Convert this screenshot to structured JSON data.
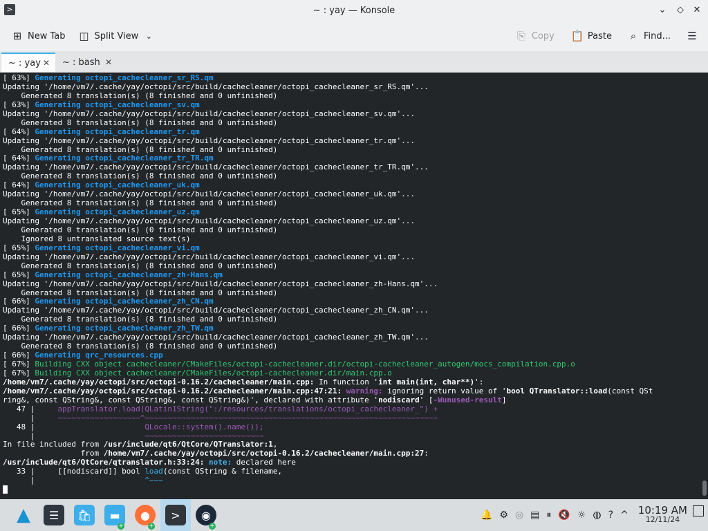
{
  "window": {
    "title": "~ : yay — Konsole",
    "app_icon": ">"
  },
  "toolbar": {
    "new_tab": "New Tab",
    "split_view": "Split View",
    "copy": "Copy",
    "paste": "Paste",
    "find": "Find..."
  },
  "tabs": [
    {
      "label": "~ : yay"
    },
    {
      "label": "~ : bash"
    }
  ],
  "terminal": [
    [
      {
        "t": "[ 63%] "
      },
      {
        "t": "Generating octopi_cachecleaner_sr_RS.qm",
        "c": "c-blue b"
      }
    ],
    [
      {
        "t": "Updating '/home/vm7/.cache/yay/octopi/src/build/cachecleaner/octopi_cachecleaner_sr_RS.qm'..."
      }
    ],
    [
      {
        "t": "    Generated 8 translation(s) (8 finished and 0 unfinished)"
      }
    ],
    [
      {
        "t": "[ 63%] "
      },
      {
        "t": "Generating octopi_cachecleaner_sv.qm",
        "c": "c-blue b"
      }
    ],
    [
      {
        "t": "Updating '/home/vm7/.cache/yay/octopi/src/build/cachecleaner/octopi_cachecleaner_sv.qm'..."
      }
    ],
    [
      {
        "t": "    Generated 8 translation(s) (8 finished and 0 unfinished)"
      }
    ],
    [
      {
        "t": "[ 64%] "
      },
      {
        "t": "Generating octopi_cachecleaner_tr.qm",
        "c": "c-blue b"
      }
    ],
    [
      {
        "t": "Updating '/home/vm7/.cache/yay/octopi/src/build/cachecleaner/octopi_cachecleaner_tr.qm'..."
      }
    ],
    [
      {
        "t": "    Generated 8 translation(s) (8 finished and 0 unfinished)"
      }
    ],
    [
      {
        "t": "[ 64%] "
      },
      {
        "t": "Generating octopi_cachecleaner_tr_TR.qm",
        "c": "c-blue b"
      }
    ],
    [
      {
        "t": "Updating '/home/vm7/.cache/yay/octopi/src/build/cachecleaner/octopi_cachecleaner_tr_TR.qm'..."
      }
    ],
    [
      {
        "t": "    Generated 8 translation(s) (8 finished and 0 unfinished)"
      }
    ],
    [
      {
        "t": "[ 64%] "
      },
      {
        "t": "Generating octopi_cachecleaner_uk.qm",
        "c": "c-blue b"
      }
    ],
    [
      {
        "t": "Updating '/home/vm7/.cache/yay/octopi/src/build/cachecleaner/octopi_cachecleaner_uk.qm'..."
      }
    ],
    [
      {
        "t": "    Generated 8 translation(s) (8 finished and 0 unfinished)"
      }
    ],
    [
      {
        "t": "[ 65%] "
      },
      {
        "t": "Generating octopi_cachecleaner_uz.qm",
        "c": "c-blue b"
      }
    ],
    [
      {
        "t": "Updating '/home/vm7/.cache/yay/octopi/src/build/cachecleaner/octopi_cachecleaner_uz.qm'..."
      }
    ],
    [
      {
        "t": "    Generated 0 translation(s) (0 finished and 0 unfinished)"
      }
    ],
    [
      {
        "t": "    Ignored 8 untranslated source text(s)"
      }
    ],
    [
      {
        "t": "[ 65%] "
      },
      {
        "t": "Generating octopi_cachecleaner_vi.qm",
        "c": "c-blue b"
      }
    ],
    [
      {
        "t": "Updating '/home/vm7/.cache/yay/octopi/src/build/cachecleaner/octopi_cachecleaner_vi.qm'..."
      }
    ],
    [
      {
        "t": "    Generated 8 translation(s) (8 finished and 0 unfinished)"
      }
    ],
    [
      {
        "t": "[ 65%] "
      },
      {
        "t": "Generating octopi_cachecleaner_zh-Hans.qm",
        "c": "c-blue b"
      }
    ],
    [
      {
        "t": "Updating '/home/vm7/.cache/yay/octopi/src/build/cachecleaner/octopi_cachecleaner_zh-Hans.qm'..."
      }
    ],
    [
      {
        "t": "    Generated 8 translation(s) (8 finished and 0 unfinished)"
      }
    ],
    [
      {
        "t": "[ 66%] "
      },
      {
        "t": "Generating octopi_cachecleaner_zh_CN.qm",
        "c": "c-blue b"
      }
    ],
    [
      {
        "t": "Updating '/home/vm7/.cache/yay/octopi/src/build/cachecleaner/octopi_cachecleaner_zh_CN.qm'..."
      }
    ],
    [
      {
        "t": "    Generated 8 translation(s) (8 finished and 0 unfinished)"
      }
    ],
    [
      {
        "t": "[ 66%] "
      },
      {
        "t": "Generating octopi_cachecleaner_zh_TW.qm",
        "c": "c-blue b"
      }
    ],
    [
      {
        "t": "Updating '/home/vm7/.cache/yay/octopi/src/build/cachecleaner/octopi_cachecleaner_zh_TW.qm'..."
      }
    ],
    [
      {
        "t": "    Generated 8 translation(s) (8 finished and 0 unfinished)"
      }
    ],
    [
      {
        "t": "[ 66%] "
      },
      {
        "t": "Generating qrc_resources.cpp",
        "c": "c-blue b"
      }
    ],
    [
      {
        "t": "[ 67%] "
      },
      {
        "t": "Building CXX object cachecleaner/CMakeFiles/octopi-cachecleaner.dir/octopi-cachecleaner_autogen/mocs_compilation.cpp.o",
        "c": "c-green2"
      }
    ],
    [
      {
        "t": "[ 67%] "
      },
      {
        "t": "Building CXX object cachecleaner/CMakeFiles/octopi-cachecleaner.dir/main.cpp.o",
        "c": "c-green2"
      }
    ],
    [
      {
        "t": "/home/vm7/.cache/yay/octopi/src/octopi-0.16.2/cachecleaner/main.cpp:",
        "c": "b"
      },
      {
        "t": " In function '"
      },
      {
        "t": "int main(int, char**)",
        "c": "b"
      },
      {
        "t": "':"
      }
    ],
    [
      {
        "t": "/home/vm7/.cache/yay/octopi/src/octopi-0.16.2/cachecleaner/main.cpp:47:21:",
        "c": "b"
      },
      {
        "t": " warning:",
        "c": "c-mag b"
      },
      {
        "t": " ignoring return value of '"
      },
      {
        "t": "bool QTranslator::load",
        "c": "b"
      },
      {
        "t": "(const QSt"
      }
    ],
    [
      {
        "t": "ring&, const QString&, const QString&, const QString&)', declared with attribute '"
      },
      {
        "t": "nodiscard",
        "c": "b"
      },
      {
        "t": "' ["
      },
      {
        "t": "-Wunused-result",
        "c": "c-mag b"
      },
      {
        "t": "]"
      }
    ],
    [
      {
        "t": "   47 |     "
      },
      {
        "t": "appTranslator.load(QLatin1String(\":/resources/translations/octopi_cachecleaner_\") +",
        "c": "c-mag"
      }
    ],
    [
      {
        "t": "      |     "
      },
      {
        "t": "~~~~~~~~~~~~~~~~~~^~~~~~~~~~~~~~~~~~~~~~~~~~~~~~~~~~~~~~~~~~~~~~~~~~~~~~~~~~~~~~~~~",
        "c": "c-mag"
      }
    ],
    [
      {
        "t": "   48 |                        "
      },
      {
        "t": "QLocale::system().name());",
        "c": "c-mag"
      }
    ],
    [
      {
        "t": "      |                        "
      },
      {
        "t": "~~~~~~~~~~~~~~~~~~~~~~~~~~",
        "c": "c-mag"
      }
    ],
    [
      {
        "t": "In file included from "
      },
      {
        "t": "/usr/include/qt6/QtCore/QTranslator:1",
        "c": "b"
      },
      {
        "t": ","
      }
    ],
    [
      {
        "t": "                 from "
      },
      {
        "t": "/home/vm7/.cache/yay/octopi/src/octopi-0.16.2/cachecleaner/main.cpp:27",
        "c": "b"
      },
      {
        "t": ":"
      }
    ],
    [
      {
        "t": "/usr/include/qt6/QtCore/qtranslator.h:33:24:",
        "c": "b"
      },
      {
        "t": " note:",
        "c": "c-cyan b"
      },
      {
        "t": " declared here"
      }
    ],
    [
      {
        "t": "   33 |     [[nodiscard]] bool "
      },
      {
        "t": "load",
        "c": "c-cyan"
      },
      {
        "t": "(const QString & filename,"
      }
    ],
    [
      {
        "t": "      |                        "
      },
      {
        "t": "^~~~",
        "c": "c-cyan"
      }
    ]
  ],
  "taskbar": {
    "clock_time": "10:19 AM",
    "clock_date": "12/11/24"
  },
  "icons": [
    "konsole-icon",
    "new-tab-icon",
    "split-view-icon",
    "copy-icon",
    "paste-icon",
    "find-icon",
    "menu-icon",
    "arch-icon",
    "settings-icon",
    "store-icon",
    "folder-icon",
    "firefox-icon",
    "terminal-icon",
    "steam-icon"
  ],
  "colors": {
    "terminal_bg": "#232629",
    "accent": "#3daee9",
    "link_blue": "#1d99f3",
    "build_green": "#2ecc71",
    "warning_magenta": "#9b59b6"
  }
}
